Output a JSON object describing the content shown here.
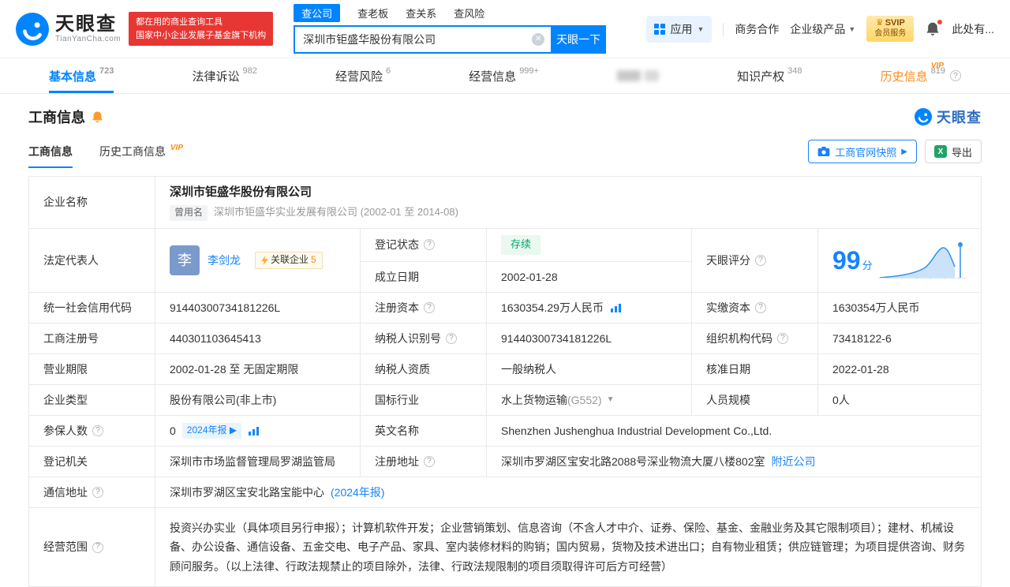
{
  "brand": {
    "name": "天眼查",
    "domain": "TianYanCha.com",
    "slogan1": "都在用的商业查询工具",
    "slogan2": "国家中小企业发展子基金旗下机构"
  },
  "search": {
    "tabs": [
      "查公司",
      "查老板",
      "查关系",
      "查风险"
    ],
    "value": "深圳市钜盛华股份有限公司",
    "button": "天眼一下"
  },
  "header_right": {
    "apps": "应用",
    "coop": "商务合作",
    "enterprise": "企业级产品",
    "svip1": "SVIP",
    "svip2": "会员服务",
    "user": "此处有..."
  },
  "nav": {
    "vip": "VIP",
    "tabs": [
      {
        "label": "基本信息",
        "count": "723"
      },
      {
        "label": "法律诉讼",
        "count": "982"
      },
      {
        "label": "经营风险",
        "count": "6"
      },
      {
        "label": "经营信息",
        "count": "999+"
      },
      {
        "label": "知识产权",
        "count": "348"
      },
      {
        "label": "历史信息",
        "count": "819"
      }
    ]
  },
  "section": {
    "title": "工商信息",
    "logo": "天眼查",
    "tab1": "工商信息",
    "tab2": "历史工商信息",
    "vip": "VIP",
    "snapshot": "工商官网快照",
    "export": "导出"
  },
  "t": {
    "company_name_label": "企业名称",
    "company_name": "深圳市钜盛华股份有限公司",
    "former_tag": "曾用名",
    "former_name": "深圳市钜盛华实业发展有限公司 (2002-01 至 2014-08)",
    "legal_rep_label": "法定代表人",
    "legal_rep_avatar": "李",
    "legal_rep_name": "李剑龙",
    "related_companies": "关联企业",
    "related_count": "5",
    "reg_status_label": "登记状态",
    "reg_status": "存续",
    "est_date_label": "成立日期",
    "est_date": "2002-01-28",
    "score_label": "天眼评分",
    "score": "99",
    "score_unit": "分",
    "credit_code_label": "统一社会信用代码",
    "credit_code": "91440300734181226L",
    "reg_capital_label": "注册资本",
    "reg_capital": "1630354.29万人民币",
    "paid_capital_label": "实缴资本",
    "paid_capital": "1630354万人民币",
    "reg_number_label": "工商注册号",
    "reg_number": "440301103645413",
    "taxpayer_id_label": "纳税人识别号",
    "taxpayer_id": "91440300734181226L",
    "org_code_label": "组织机构代码",
    "org_code": "73418122-6",
    "business_term_label": "营业期限",
    "business_term": "2002-01-28 至 无固定期限",
    "taxpayer_quality_label": "纳税人资质",
    "taxpayer_quality": "一般纳税人",
    "approval_date_label": "核准日期",
    "approval_date": "2022-01-28",
    "company_type_label": "企业类型",
    "company_type": "股份有限公司(非上市)",
    "industry_label": "国标行业",
    "industry": "水上货物运输",
    "industry_code": "(G552)",
    "staff_size_label": "人员规模",
    "staff_size": "0人",
    "insured_label": "参保人数",
    "insured": "0",
    "annual_report_tag": "2024年报",
    "english_name_label": "英文名称",
    "english_name": "Shenzhen Jushenghua Industrial Development Co.,Ltd.",
    "reg_authority_label": "登记机关",
    "reg_authority": "深圳市市场监督管理局罗湖监管局",
    "reg_address_label": "注册地址",
    "reg_address": "深圳市罗湖区宝安北路2088号深业物流大厦八楼802室",
    "nearby_link": "附近公司",
    "mail_address_label": "通信地址",
    "mail_address": "深圳市罗湖区宝安北路宝能中心",
    "mail_report_link": "(2024年报)",
    "business_scope_label": "经营范围",
    "business_scope": "投资兴办实业（具体项目另行申报）；计算机软件开发；企业营销策划、信息咨询（不含人才中介、证券、保险、基金、金融业务及其它限制项目）；建材、机械设备、办公设备、通信设备、五金交电、电子产品、家具、室内装修材料的购销；国内贸易，货物及技术进出口；自有物业租赁；供应链管理；为项目提供咨询、财务顾问服务。（以上法律、行政法规禁止的项目除外，法律、行政法规限制的项目须取得许可后方可经营）"
  }
}
